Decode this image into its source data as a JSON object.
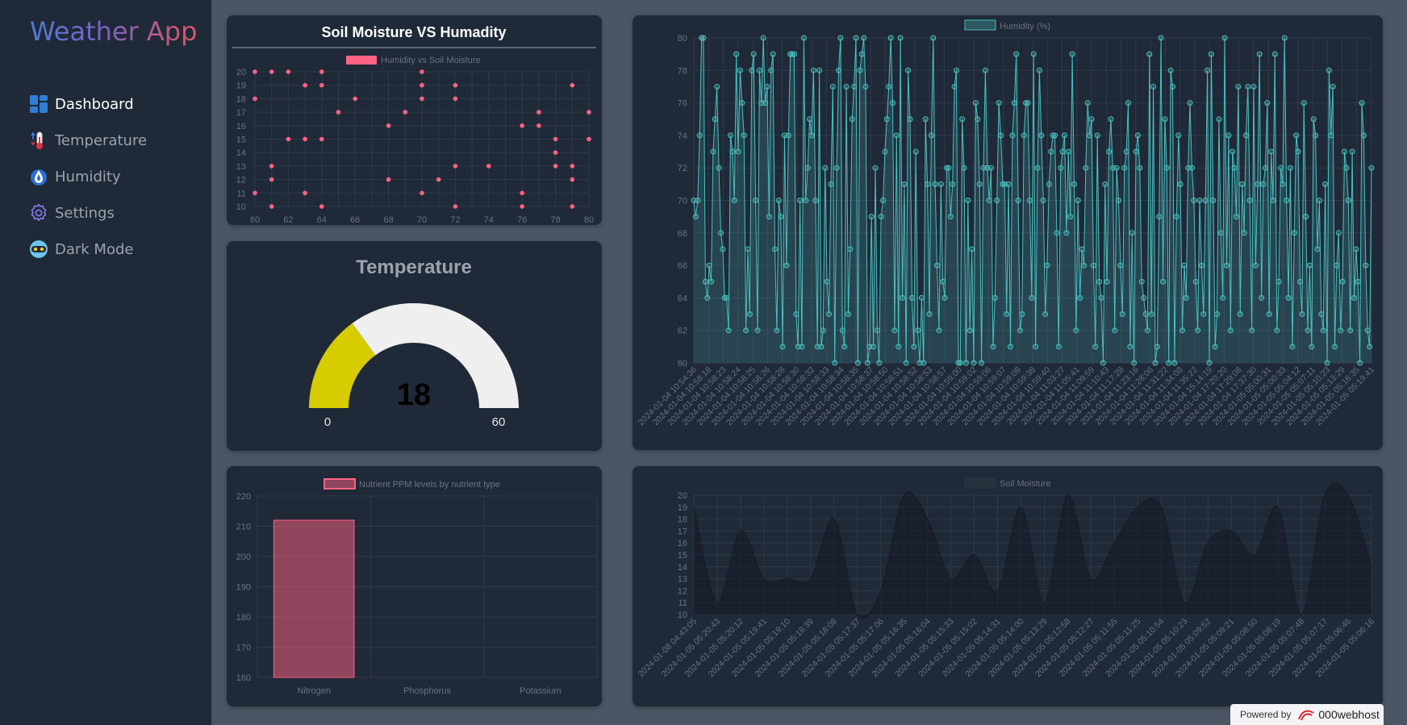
{
  "app": {
    "title": "Weather App"
  },
  "nav": [
    {
      "label": "Dashboard",
      "icon": "dashboard-icon",
      "active": true
    },
    {
      "label": "Temperature",
      "icon": "thermometer-icon",
      "active": false
    },
    {
      "label": "Humidity",
      "icon": "droplet-icon",
      "active": false
    },
    {
      "label": "Settings",
      "icon": "gear-icon",
      "active": false
    },
    {
      "label": "Dark Mode",
      "icon": "dark-mode-icon",
      "active": false
    }
  ],
  "colors": {
    "pink": "#ff6384",
    "teal": "#4bc0c0",
    "yellow": "#d6cc00",
    "gauge_rest": "#efefef",
    "card": "#1f2937",
    "page": "#4b5564"
  },
  "scatter_card": {
    "title": "Soil Moisture VS Humadity"
  },
  "temperature_card": {
    "title": "Temperature",
    "value": 18,
    "min": 0,
    "max": 60,
    "min_label": "0",
    "max_label": "60"
  },
  "footer": {
    "powered_label": "Powered by",
    "host": "000webhost"
  },
  "chart_data": [
    {
      "id": "scatter",
      "type": "scatter",
      "legend": "Humidity vs Soil Moisture",
      "xlim": [
        60,
        80
      ],
      "ylim": [
        10,
        20
      ],
      "x_ticks": [
        "60",
        "62",
        "64",
        "66",
        "68",
        "70",
        "72",
        "74",
        "76",
        "78",
        "80"
      ],
      "y_ticks": [
        "20",
        "19",
        "18",
        "17",
        "16",
        "15",
        "14",
        "13",
        "12",
        "11",
        "10"
      ],
      "points": [
        [
          60,
          20
        ],
        [
          61,
          20
        ],
        [
          62,
          20
        ],
        [
          64,
          20
        ],
        [
          63,
          19
        ],
        [
          64,
          19
        ],
        [
          70,
          20
        ],
        [
          72,
          19
        ],
        [
          70,
          19
        ],
        [
          79,
          19
        ],
        [
          60,
          18
        ],
        [
          66,
          18
        ],
        [
          70,
          18
        ],
        [
          72,
          18
        ],
        [
          65,
          17
        ],
        [
          69,
          17
        ],
        [
          77,
          17
        ],
        [
          80,
          17
        ],
        [
          68,
          16
        ],
        [
          76,
          16
        ],
        [
          77,
          16
        ],
        [
          62,
          15
        ],
        [
          63,
          15
        ],
        [
          64,
          15
        ],
        [
          78,
          15
        ],
        [
          80,
          15
        ],
        [
          78,
          14
        ],
        [
          61,
          13
        ],
        [
          72,
          13
        ],
        [
          74,
          13
        ],
        [
          78,
          13
        ],
        [
          79,
          13
        ],
        [
          61,
          12
        ],
        [
          68,
          12
        ],
        [
          71,
          12
        ],
        [
          79,
          12
        ],
        [
          60,
          11
        ],
        [
          63,
          11
        ],
        [
          70,
          11
        ],
        [
          76,
          11
        ],
        [
          61,
          10
        ],
        [
          64,
          10
        ],
        [
          72,
          10
        ],
        [
          76,
          10
        ],
        [
          79,
          10
        ]
      ]
    },
    {
      "id": "humidity",
      "type": "line",
      "legend": "Humidity (%)",
      "ylim": [
        60,
        80
      ],
      "y_ticks": [
        "80",
        "78",
        "76",
        "74",
        "72",
        "70",
        "68",
        "66",
        "64",
        "62",
        "60"
      ],
      "x_tick_labels": [
        "2024-01-04 10:54:36",
        "2024-01-04 10:58:18",
        "2024-01-04 10:58:23",
        "2024-01-04 10:58:24",
        "2024-01-04 10:58:25",
        "2024-01-04 10:58:26",
        "2024-01-04 10:58:28",
        "2024-01-04 10:58:30",
        "2024-01-04 10:58:32",
        "2024-01-04 10:58:33",
        "2024-01-04 10:58:34",
        "2024-01-04 10:58:35",
        "2024-01-04 10:58:37",
        "2024-01-04 10:58:50",
        "2024-01-04 10:58:51",
        "2024-01-04 10:58:52",
        "2024-01-04 10:58:53",
        "2024-01-04 10:58:57",
        "2024-01-04 10:59:00",
        "2024-01-04 10:59:02",
        "2024-01-04 10:59:06",
        "2024-01-04 10:59:07",
        "2024-01-04 10:59:08",
        "2024-01-04 10:59:38",
        "2024-01-04 10:59:40",
        "2024-01-04 11:03:27",
        "2024-01-04 11:05:41",
        "2024-01-04 11:09:59",
        "2024-01-04 11:10:43",
        "2024-01-04 11:17:28",
        "2024-01-04 11:23:16",
        "2024-01-04 11:28:06",
        "2024-01-04 11:31:22",
        "2024-01-04 11:34:08",
        "2024-01-04 11:35:22",
        "2024-01-04 15:14:19",
        "2024-01-04 17:20:20",
        "2024-01-04 17:29:08",
        "2024-01-04 17:37:30",
        "2024-01-05 05:00:31",
        "2024-01-05 05:00:33",
        "2024-01-05 05:04:12",
        "2024-01-05 05:07:11",
        "2024-01-05 05:10:23",
        "2024-01-05 05:13:29",
        "2024-01-05 05:16:35",
        "2024-01-05 05:19:41"
      ],
      "values": [
        70,
        69,
        70,
        74,
        80,
        80,
        65,
        64,
        66,
        65,
        73,
        75,
        77,
        72,
        68,
        67,
        64,
        64,
        62,
        74,
        73,
        70,
        79,
        73,
        78,
        76,
        74,
        62,
        67,
        63,
        78,
        79,
        70,
        62,
        78,
        76,
        80,
        76,
        77,
        69,
        78,
        79,
        67,
        62,
        70,
        69,
        61,
        74,
        66,
        74,
        79,
        79,
        79,
        63,
        61,
        70,
        61,
        80,
        70,
        72,
        75,
        74,
        78,
        70,
        61,
        78,
        61,
        62,
        72,
        65,
        63,
        71,
        77,
        60,
        72,
        78,
        80,
        62,
        61,
        77,
        63,
        67,
        75,
        77,
        80,
        60,
        78,
        79,
        80,
        77,
        60,
        61,
        69,
        61,
        72,
        62,
        60,
        69,
        70,
        73,
        75,
        77,
        80,
        76,
        62,
        74,
        61,
        80,
        64,
        71,
        60,
        78,
        75,
        64,
        61,
        73,
        62,
        60,
        64,
        60,
        75,
        71,
        63,
        74,
        80,
        71,
        66,
        62,
        71,
        65,
        64,
        72,
        72,
        69,
        71,
        77,
        78,
        60,
        60,
        75,
        72,
        60,
        70,
        62,
        67,
        60,
        76,
        75,
        71,
        60,
        72,
        78,
        72,
        70,
        72,
        61,
        64,
        70,
        76,
        74,
        71,
        71,
        63,
        71,
        61,
        74,
        76,
        79,
        70,
        62,
        63,
        74,
        76,
        76,
        70,
        64,
        79,
        61,
        72,
        78,
        74,
        70,
        63,
        66,
        71,
        73,
        74,
        74,
        68,
        61,
        72,
        73,
        74,
        68,
        73,
        69,
        79,
        71,
        62,
        70,
        64,
        67,
        66,
        72,
        76,
        74,
        75,
        66,
        61,
        74,
        65,
        64,
        60,
        71,
        65,
        73,
        75,
        72,
        62,
        72,
        70,
        66,
        63,
        72,
        73,
        76,
        61,
        68,
        60,
        73,
        74,
        72,
        65,
        64,
        63,
        62,
        79,
        63,
        77,
        60,
        61,
        69,
        80,
        65,
        75,
        72,
        60,
        78,
        77,
        60,
        69,
        74,
        71,
        62,
        66,
        64,
        72,
        76,
        72,
        70,
        65,
        62,
        70,
        66,
        63,
        70,
        78,
        60,
        79,
        70,
        61,
        63,
        75,
        68,
        64,
        80,
        66,
        74,
        62,
        73,
        72,
        69,
        77,
        63,
        71,
        68,
        74,
        77,
        70,
        62,
        77,
        66,
        71,
        79,
        64,
        71,
        72,
        76,
        63,
        73,
        70,
        79,
        62,
        65,
        72,
        71,
        80,
        70,
        64,
        72,
        61,
        68,
        74,
        73,
        65,
        63,
        76,
        69,
        62,
        66,
        61,
        75,
        74,
        67,
        70,
        63,
        62,
        71,
        60,
        78,
        74,
        77,
        61,
        66,
        68,
        62,
        65,
        73,
        72,
        70,
        62,
        73,
        64,
        67,
        65,
        60,
        76,
        74,
        66,
        62,
        61,
        72
      ]
    },
    {
      "id": "nutrients",
      "type": "bar",
      "legend": "Nutrient PPM levels by nutrient type",
      "categories": [
        "Nitrogen",
        "Phosphorus",
        "Potassium"
      ],
      "values": [
        212,
        0,
        0
      ],
      "ylim": [
        160,
        220
      ],
      "y_ticks": [
        "220",
        "210",
        "200",
        "190",
        "180",
        "170",
        "160"
      ]
    },
    {
      "id": "soil",
      "type": "area",
      "legend": "Soil Moisture",
      "ylim": [
        10,
        20
      ],
      "y_ticks": [
        "20",
        "19",
        "18",
        "17",
        "16",
        "15",
        "14",
        "13",
        "12",
        "11",
        "10"
      ],
      "x_tick_labels": [
        "2024-01-08 04:43:05",
        "2024-01-05 05:20:43",
        "2024-01-05 05:20:12",
        "2024-01-05 05:19:41",
        "2024-01-05 05:19:10",
        "2024-01-05 05:18:39",
        "2024-01-05 05:18:08",
        "2024-01-05 05:17:37",
        "2024-01-05 05:17:06",
        "2024-01-05 05:16:35",
        "2024-01-05 05:16:04",
        "2024-01-05 05:15:33",
        "2024-01-05 05:15:02",
        "2024-01-05 05:14:31",
        "2024-01-05 05:14:00",
        "2024-01-05 05:13:29",
        "2024-01-05 05:12:58",
        "2024-01-05 05:12:27",
        "2024-01-05 05:11:55",
        "2024-01-05 05:11:25",
        "2024-01-05 05:10:54",
        "2024-01-05 05:10:23",
        "2024-01-05 05:09:52",
        "2024-01-05 05:09:21",
        "2024-01-05 05:08:50",
        "2024-01-05 05:08:19",
        "2024-01-05 05:07:48",
        "2024-01-05 05:07:17",
        "2024-01-05 05:06:46",
        "2024-01-05 05:06:16"
      ],
      "values": [
        19,
        11,
        17,
        13,
        13,
        13,
        18,
        10,
        12,
        20,
        18,
        13,
        15,
        12,
        19,
        11,
        20,
        13,
        16,
        19,
        19,
        11,
        16,
        17,
        15,
        19,
        10,
        20,
        20,
        14
      ]
    }
  ]
}
